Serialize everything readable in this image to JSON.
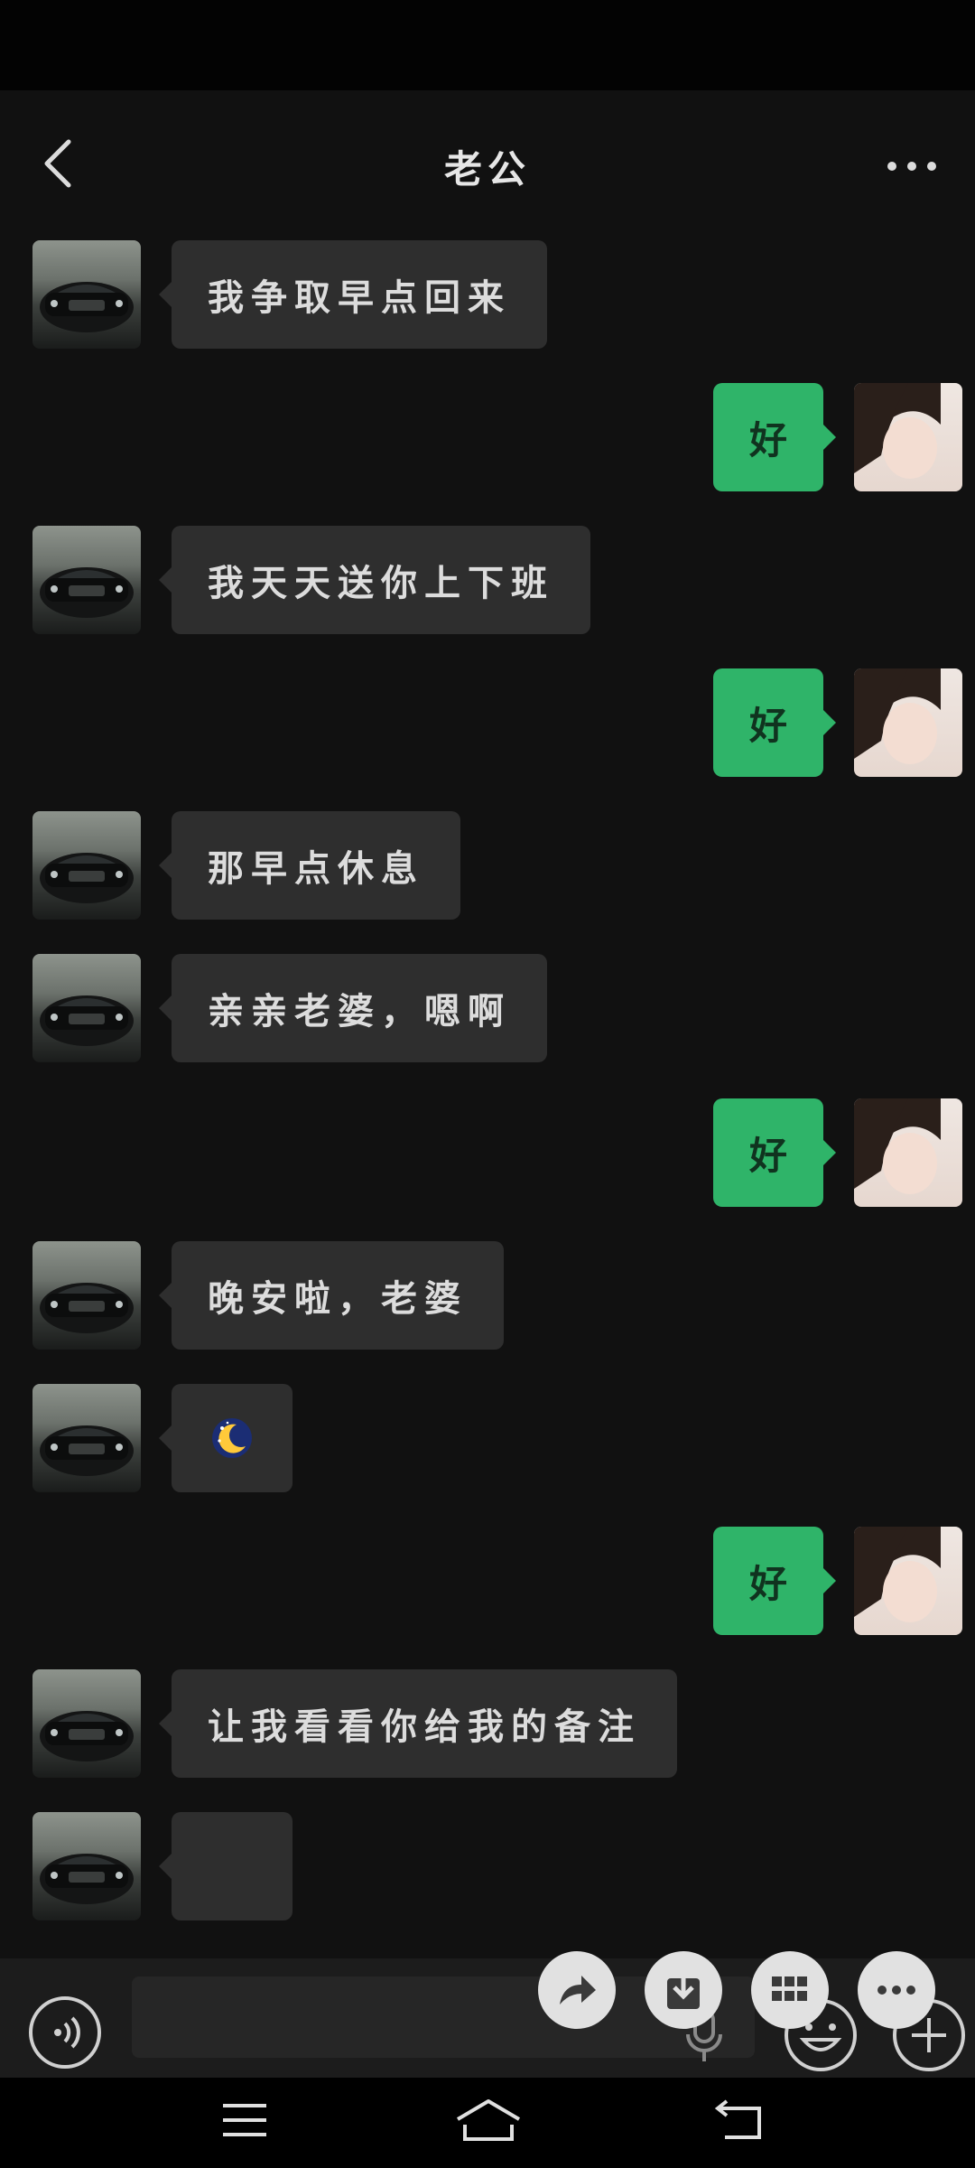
{
  "header": {
    "title": "老公"
  },
  "messages": [
    {
      "side": "left",
      "text": "我争取早点回来"
    },
    {
      "side": "right",
      "text": "好"
    },
    {
      "side": "left",
      "text": "我天天送你上下班"
    },
    {
      "side": "right",
      "text": "好"
    },
    {
      "side": "left",
      "text": "那早点休息"
    },
    {
      "side": "left",
      "text": "亲亲老婆，嗯啊"
    },
    {
      "side": "right",
      "text": "好"
    },
    {
      "side": "left",
      "text": "晚安啦，老婆"
    },
    {
      "side": "left",
      "icon": "moon-stars-icon"
    },
    {
      "side": "right",
      "text": "好"
    },
    {
      "side": "left",
      "text": "让我看看你给我的备注"
    },
    {
      "side": "left",
      "text": ""
    }
  ],
  "toolbar": {
    "left_icon": "voice-icon",
    "floating_actions": [
      "forward-icon",
      "save-download-icon",
      "grid-icon",
      "more-icon"
    ],
    "right_icons": [
      "microphone-icon",
      "emoji-icon",
      "plus-icon"
    ]
  },
  "colors": {
    "sent_bubble": "#2fb469",
    "received_bubble": "#2e2e2e",
    "background": "#111111"
  }
}
